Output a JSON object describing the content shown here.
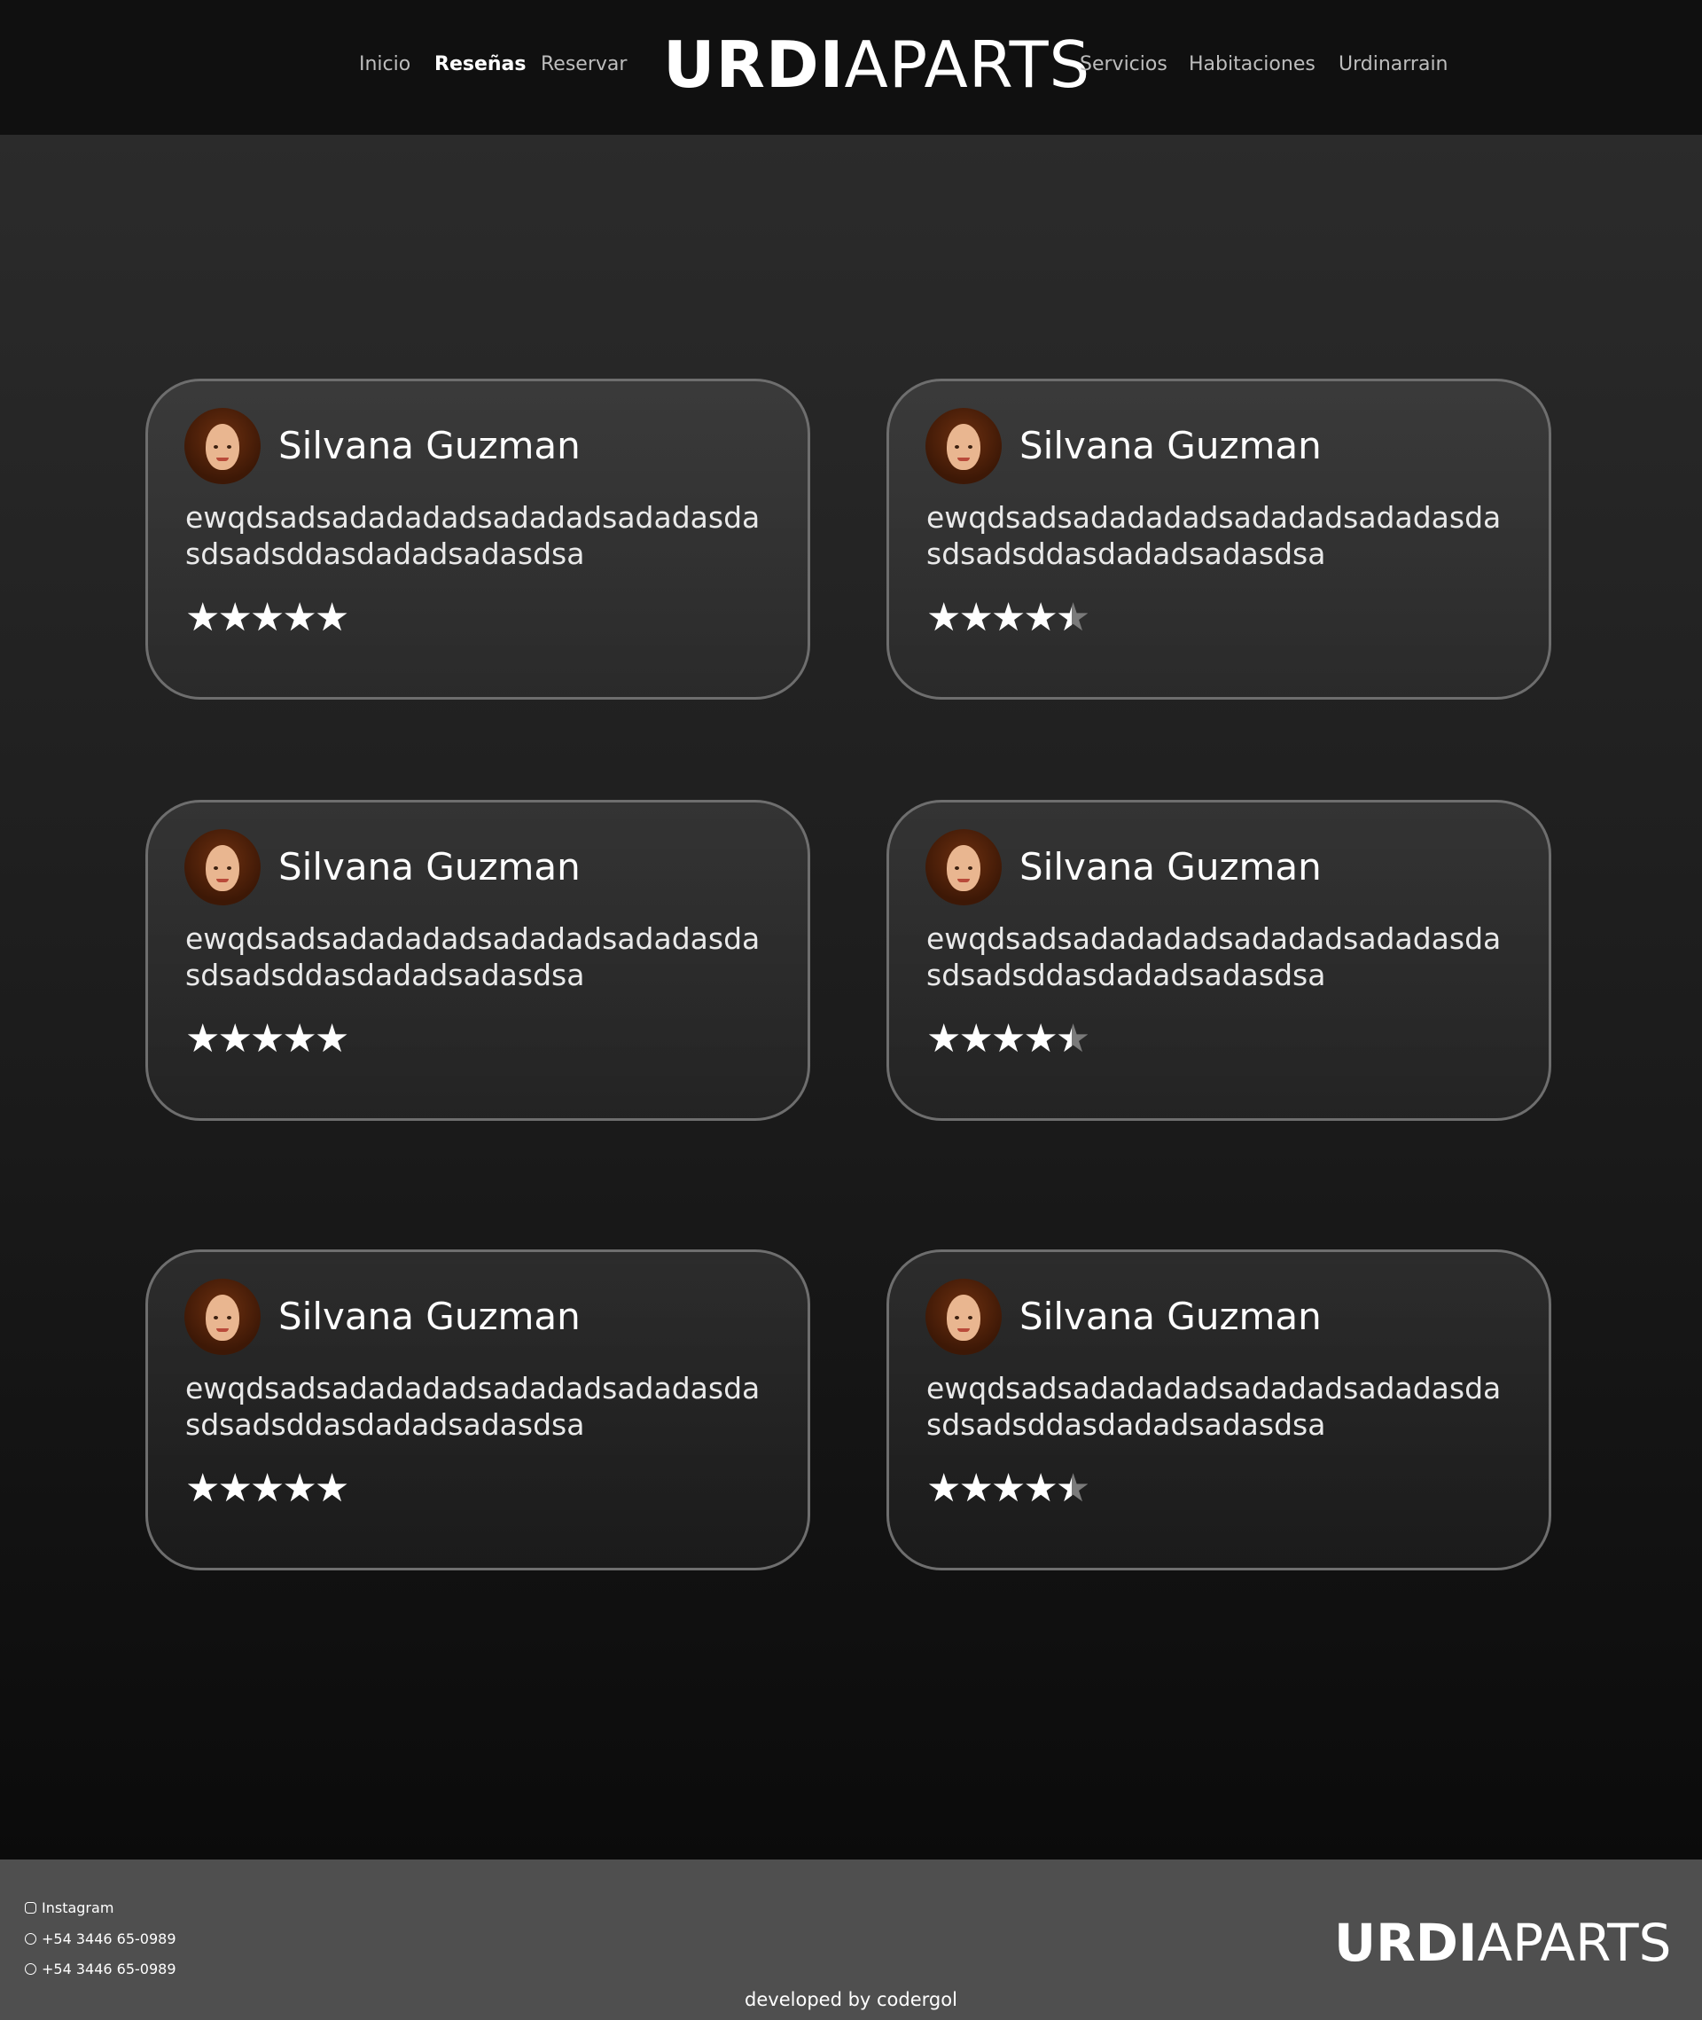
{
  "header": {
    "nav_left": [
      "Inicio",
      "Reseñas",
      "Reservar"
    ],
    "nav_right": [
      "Servicios",
      "Habitaciones",
      "Urdinarrain"
    ],
    "logo_bold": "URDI",
    "logo_light": "APARTS",
    "active_item": "Reseñas"
  },
  "reviews": [
    {
      "name": "Silvana Guzman",
      "text": "ewqdsadsadadadadsadadadsadadasdasdsadsddasdadadsadasdsa",
      "rating": 5
    },
    {
      "name": "Silvana Guzman",
      "text": "ewqdsadsadadadadsadadadsadadasdasdsadsddasdadadsadasdsa",
      "rating": 4.5
    },
    {
      "name": "Silvana Guzman",
      "text": "ewqdsadsadadadadsadadadsadadasdasdsadsddasdadadsadasdsa",
      "rating": 5
    },
    {
      "name": "Silvana Guzman",
      "text": "ewqdsadsadadadadsadadadsadadasdasdsadsddasdadadsadasdsa",
      "rating": 4.5
    },
    {
      "name": "Silvana Guzman",
      "text": "ewqdsadsadadadadsadadadsadadasdasdsadsddasdadadsadasdsa",
      "rating": 5
    },
    {
      "name": "Silvana Guzman",
      "text": "ewqdsadsadadadadsadadadsadadasdasdsadsddasdadadsadasdsa",
      "rating": 4.5
    }
  ],
  "footer": {
    "instagram": "Instagram",
    "whatsapp": "+54 3446 65-0989",
    "phone": "+54 3446 65-0989",
    "icons": [
      "instagram-icon",
      "whatsapp-icon",
      "phone-icon"
    ],
    "logo_bold": "URDI",
    "logo_light": "APARTS",
    "developed_by": "developed by codergol"
  },
  "colors": {
    "header_bg": "#101010",
    "footer_bg": "#4f4f4f",
    "card_border": "#6e6e6e",
    "text": "#ffffff"
  }
}
